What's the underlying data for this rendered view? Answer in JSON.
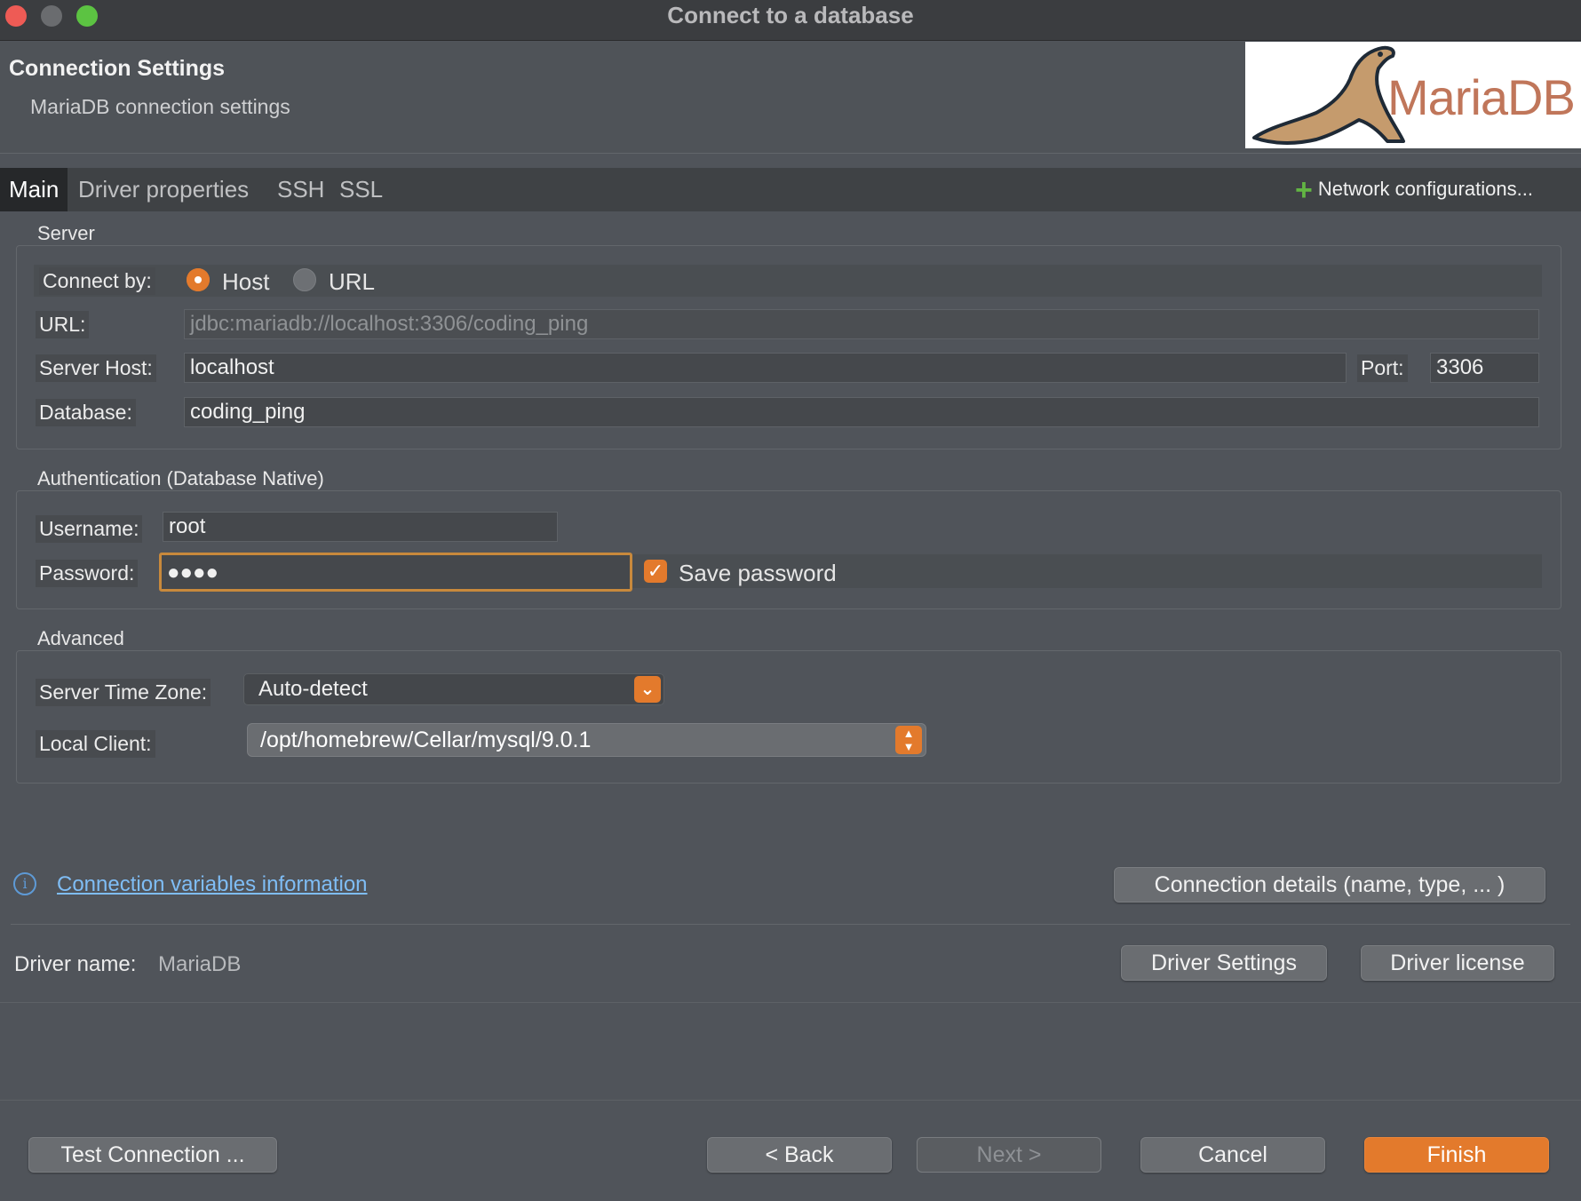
{
  "window": {
    "title": "Connect to a database",
    "traffic_lights": [
      "close",
      "minimize",
      "zoom"
    ]
  },
  "header": {
    "title": "Connection Settings",
    "subtitle": "MariaDB connection settings",
    "logo_text": "MariaDB"
  },
  "tabs": [
    {
      "label": "Main",
      "active": true
    },
    {
      "label": "Driver properties",
      "active": false
    },
    {
      "label": "SSH",
      "active": false
    },
    {
      "label": "SSL",
      "active": false
    }
  ],
  "network_configurations": "Network configurations...",
  "server": {
    "section_label": "Server",
    "connect_by_label": "Connect by:",
    "connect_by_options": [
      {
        "label": "Host",
        "selected": true
      },
      {
        "label": "URL",
        "selected": false
      }
    ],
    "url_label": "URL:",
    "url_value": "jdbc:mariadb://localhost:3306/coding_ping",
    "host_label": "Server Host:",
    "host_value": "localhost",
    "port_label": "Port:",
    "port_value": "3306",
    "database_label": "Database:",
    "database_value": "coding_ping"
  },
  "auth": {
    "section_label": "Authentication (Database Native)",
    "username_label": "Username:",
    "username_value": "root",
    "password_label": "Password:",
    "password_value": "●●●●",
    "save_password_label": "Save password",
    "save_password_checked": true
  },
  "advanced": {
    "section_label": "Advanced",
    "timezone_label": "Server Time Zone:",
    "timezone_value": "Auto-detect",
    "local_client_label": "Local Client:",
    "local_client_value": "/opt/homebrew/Cellar/mysql/9.0.1"
  },
  "footer": {
    "variables_link": "Connection variables information",
    "connection_details_button": "Connection details (name, type, ... )",
    "driver_name_label": "Driver name:",
    "driver_name_value": "MariaDB",
    "driver_settings_button": "Driver Settings",
    "driver_license_button": "Driver license"
  },
  "actions": {
    "test_connection": "Test Connection ...",
    "back": "< Back",
    "next": "Next >",
    "cancel": "Cancel",
    "finish": "Finish"
  },
  "colors": {
    "accent": "#e37a2c",
    "link": "#7fbdf5",
    "background": "#50545a",
    "add_icon": "#62b543"
  },
  "icons": {
    "add": "plus-icon",
    "info": "info-icon",
    "dropdown": "chevron-down-icon",
    "stepper": "up-down-chevron-icon",
    "check": "checkmark-icon"
  }
}
